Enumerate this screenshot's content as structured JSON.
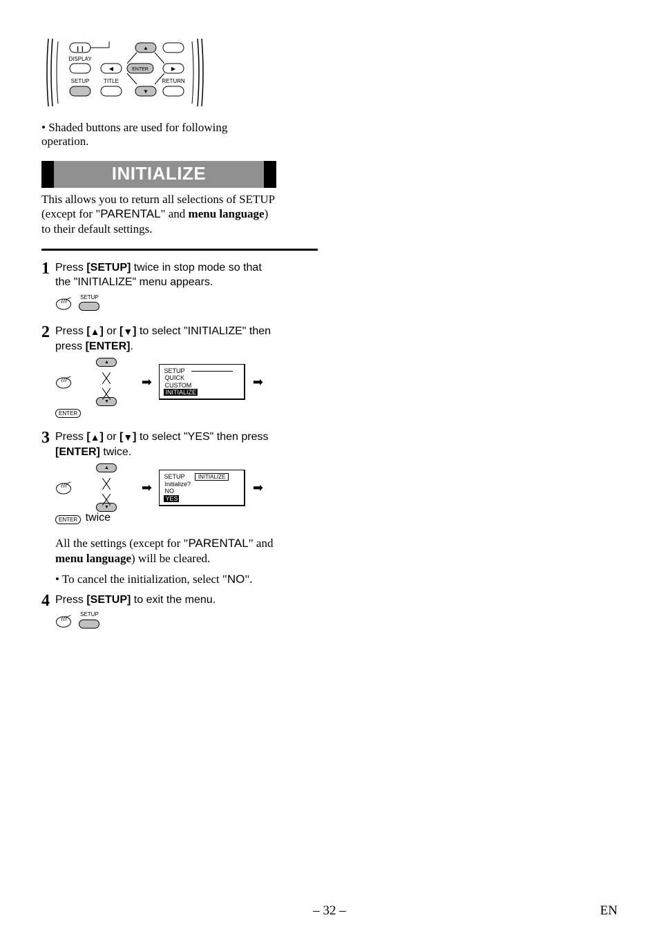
{
  "remote": {
    "labels": {
      "display": "DISPLAY",
      "setup": "SETUP",
      "title": "TITLE",
      "return": "RETURN",
      "enter": "ENTER"
    }
  },
  "shaded_note": "Shaded buttons are used for following operation.",
  "section_title": "INITIALIZE",
  "intro": {
    "line1": "This allows you to return all selections of SETUP (except for \"",
    "parental": "PARENTAL",
    "line1b": "\" and ",
    "menulang": "menu language",
    "line1c": ") to their default settings."
  },
  "steps": {
    "s1": {
      "num": "1",
      "t1": "Press ",
      "setup": "[SETUP]",
      "t2": " twice in stop mode so that the \"INITIALIZE\" menu appears.",
      "btn_label": "SETUP"
    },
    "s2": {
      "num": "2",
      "t1": "Press ",
      "or": " or ",
      "t2": " to select \"INITIALIZE\" then press ",
      "enter": "[ENTER]",
      "period": ".",
      "menu": {
        "title": "SETUP",
        "opt1": "QUICK",
        "opt2": "CUSTOM",
        "opt3": "INITIALIZE"
      },
      "entercap": "ENTER"
    },
    "s3": {
      "num": "3",
      "t1": "Press ",
      "or": " or ",
      "t2": " to select \"YES\" then press ",
      "enter": "[ENTER]",
      "t3": " twice.",
      "menu": {
        "title": "SETUP",
        "head": "INITIALIZE",
        "opt1": "Initialize?",
        "opt2": "NO",
        "opt3": "YES"
      },
      "entercap": "ENTER",
      "twice": "twice",
      "note1a": "All the settings (except for \"",
      "parental": "PARENTAL",
      "note1b": "\" and ",
      "menulang": "menu language",
      "note1c": ") will be cleared.",
      "note2a": "To cancel the initialization, select \"",
      "no": "NO",
      "note2b": "\"."
    },
    "s4": {
      "num": "4",
      "t1": "Press ",
      "setup": "[SETUP]",
      "t2": " to exit the menu.",
      "btn_label": "SETUP"
    }
  },
  "footer": {
    "page": "– 32 –",
    "lang": "EN"
  }
}
